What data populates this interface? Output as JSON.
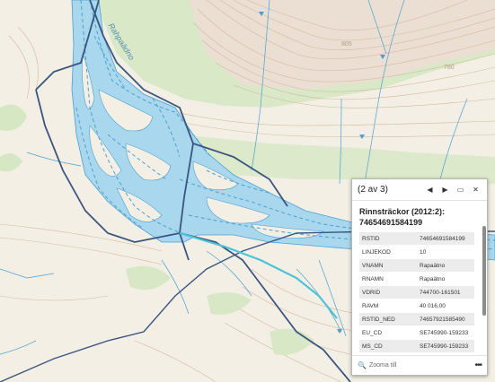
{
  "map": {
    "river_label": "Rahpaädno",
    "contour_labels": [
      "805",
      "780"
    ]
  },
  "popup": {
    "counter": "(2 av 3)",
    "prev_icon": "◀",
    "next_icon": "▶",
    "dock_icon": "▭",
    "close_icon": "✕",
    "title": "Rinnsträckor (2012:2): 74654691584199",
    "rows": [
      {
        "key": "RSTID",
        "value": "74654691584199"
      },
      {
        "key": "LINJEKOD",
        "value": "10"
      },
      {
        "key": "VNAMN",
        "value": "Rapaätno"
      },
      {
        "key": "RNAMN",
        "value": "Rapaätno"
      },
      {
        "key": "VDRID",
        "value": "744700-161501"
      },
      {
        "key": "RAVM",
        "value": "40 016,00"
      },
      {
        "key": "RSTID_NED",
        "value": "74657921585490"
      },
      {
        "key": "EU_CD",
        "value": "SE745990-159233"
      },
      {
        "key": "MS_CD",
        "value": "SE745990-159233"
      }
    ],
    "zoom_label": "Zooma till",
    "more_icon": "•••"
  },
  "colors": {
    "water": "#a8d7ee",
    "water_line": "#4ca0d0",
    "boundary": "#3a5680",
    "highlight": "#4cc3d6",
    "vegetation": "#d6e6c4"
  }
}
